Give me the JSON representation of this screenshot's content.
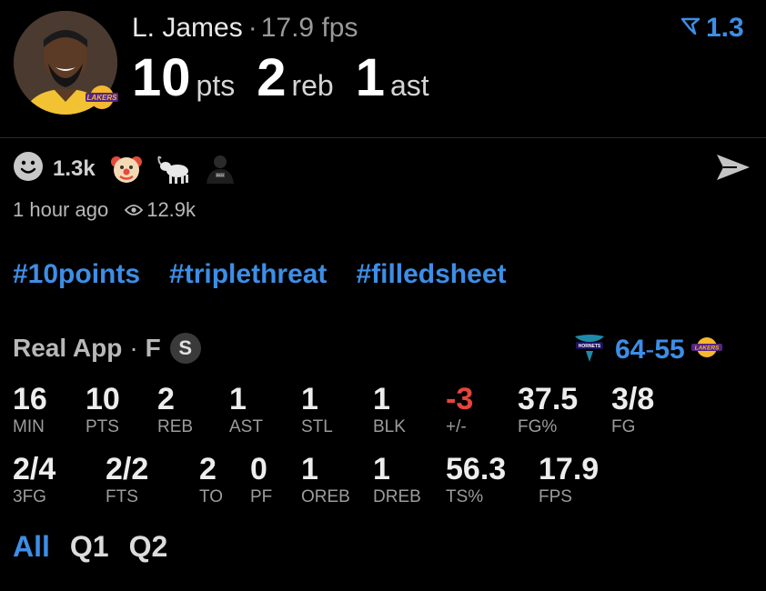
{
  "header": {
    "player_name": "L. James",
    "separator": "·",
    "fps_text": "17.9 fps",
    "rating": "1.3",
    "line": [
      {
        "value": "10",
        "unit": "pts"
      },
      {
        "value": "2",
        "unit": "reb"
      },
      {
        "value": "1",
        "unit": "ast"
      }
    ]
  },
  "social": {
    "reaction_count": "1.3k",
    "reactions": [
      "clown-emoji",
      "goat-emoji",
      "nets-player-emoji"
    ],
    "time_ago": "1 hour ago",
    "views": "12.9k"
  },
  "hashtags": [
    "#10points",
    "#triplethreat",
    "#filledsheet"
  ],
  "game": {
    "source": "Real App",
    "separator": "·",
    "status": "F",
    "badge": "S",
    "home_score": "64",
    "score_sep": "-",
    "away_score": "55"
  },
  "stats": [
    {
      "value": "16",
      "label": "MIN"
    },
    {
      "value": "10",
      "label": "PTS"
    },
    {
      "value": "2",
      "label": "REB"
    },
    {
      "value": "1",
      "label": "AST"
    },
    {
      "value": "1",
      "label": "STL"
    },
    {
      "value": "1",
      "label": "BLK"
    },
    {
      "value": "-3",
      "label": "+/-"
    },
    {
      "value": "37.5",
      "label": "FG%"
    },
    {
      "value": "3/8",
      "label": "FG"
    },
    {
      "value": "2/4",
      "label": "3FG"
    },
    {
      "value": "2/2",
      "label": "FTS"
    },
    {
      "value": "2",
      "label": "TO"
    },
    {
      "value": "0",
      "label": "PF"
    },
    {
      "value": "1",
      "label": "OREB"
    },
    {
      "value": "1",
      "label": "DREB"
    },
    {
      "value": "56.3",
      "label": "TS%"
    },
    {
      "value": "17.9",
      "label": "FPS"
    }
  ],
  "tabs": [
    "All",
    "Q1",
    "Q2"
  ],
  "colors": {
    "accent": "#3d8ee6",
    "negative": "#e5453c",
    "background": "#000000"
  }
}
